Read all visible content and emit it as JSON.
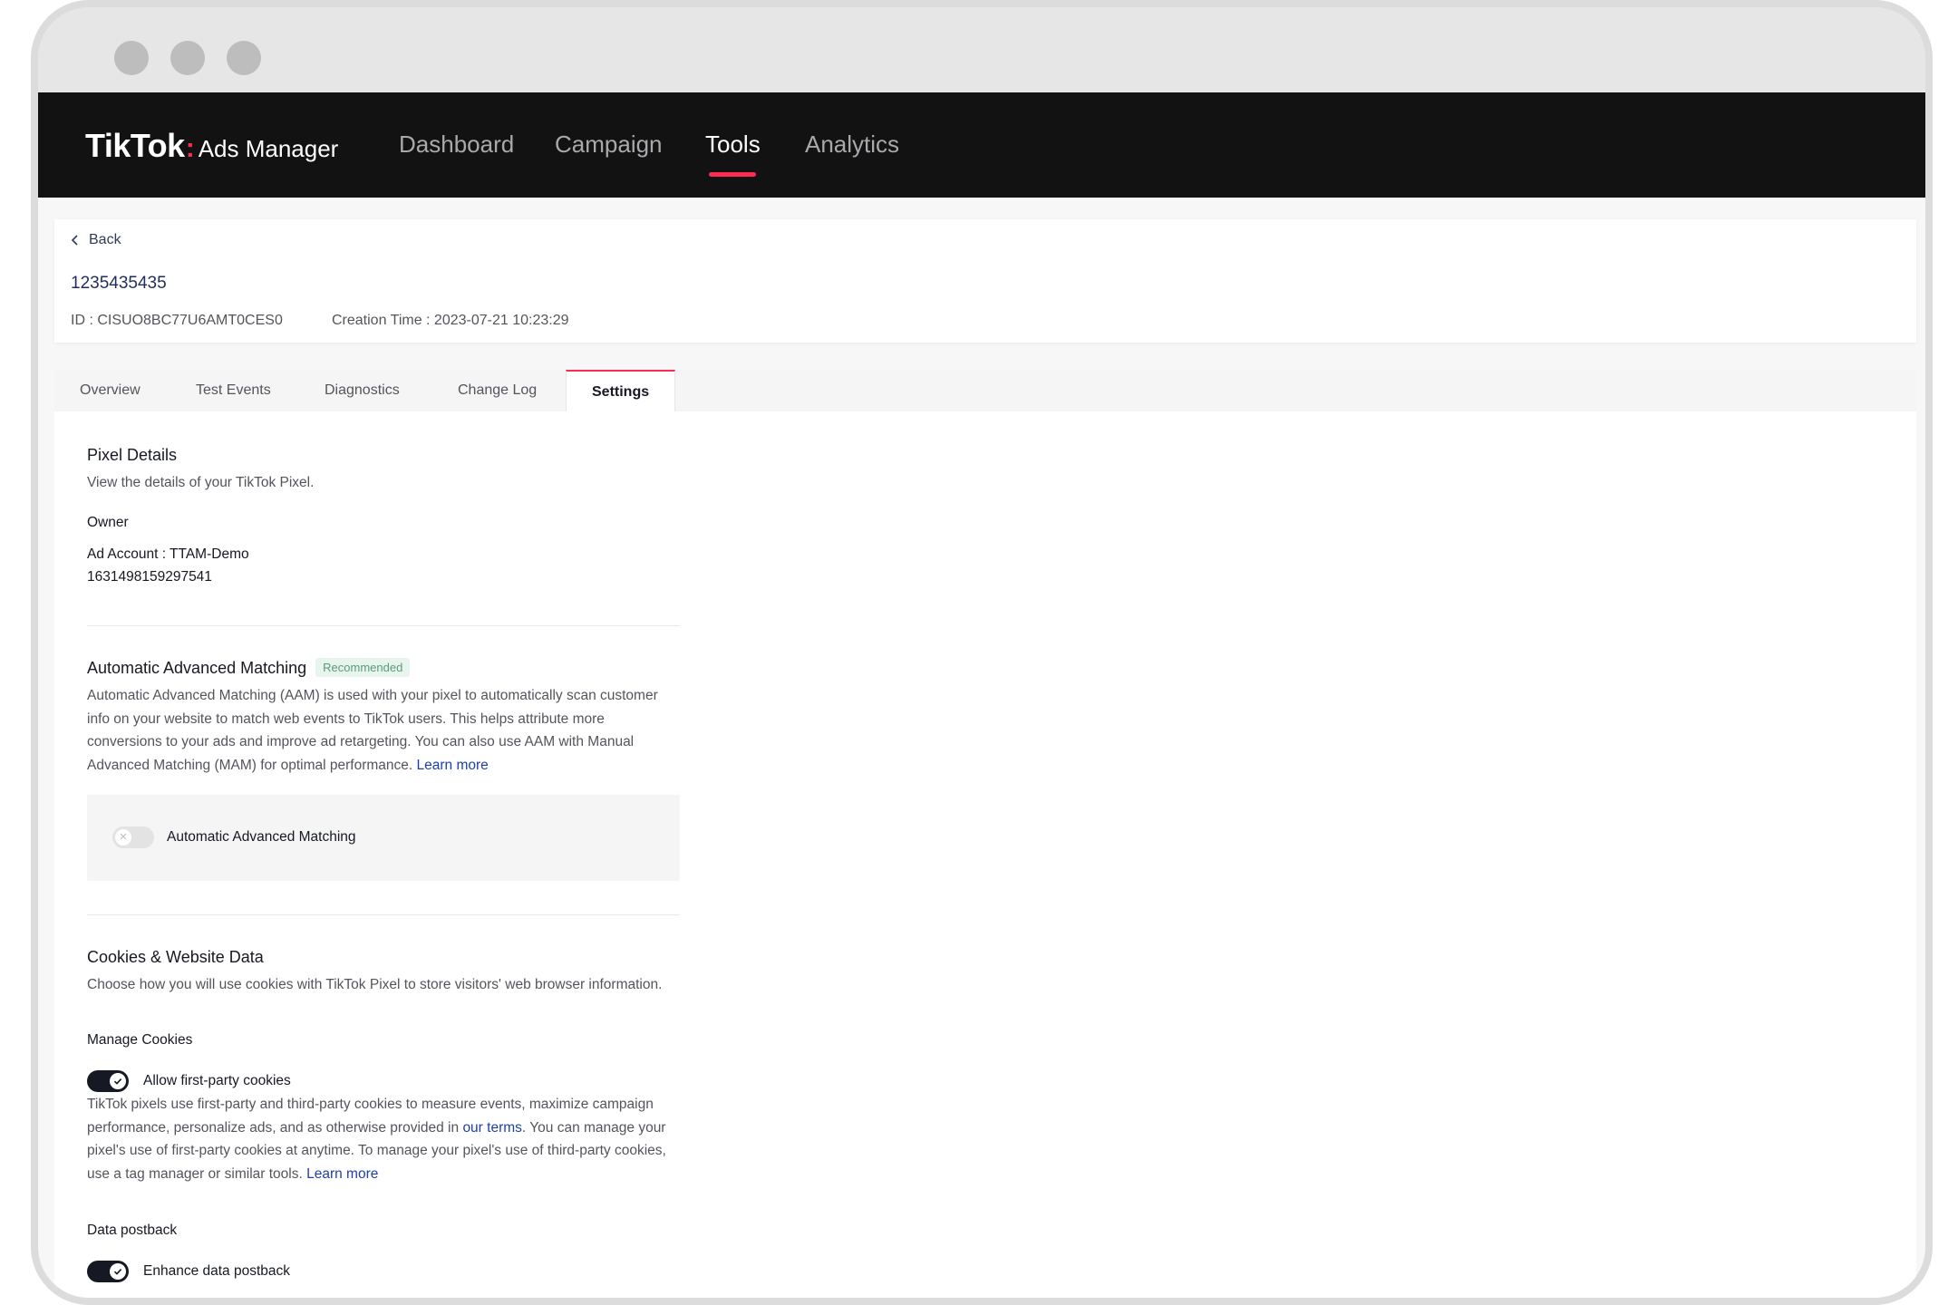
{
  "window": {
    "controls": [
      "close",
      "minimize",
      "maximize"
    ]
  },
  "navbar": {
    "brand": "TikTok",
    "brand_colon": ":",
    "product": "Ads Manager",
    "items": [
      {
        "label": "Dashboard",
        "active": false
      },
      {
        "label": "Campaign",
        "active": false
      },
      {
        "label": "Tools",
        "active": true
      },
      {
        "label": "Analytics",
        "active": false
      }
    ],
    "accent_color": "#fe2c55"
  },
  "header": {
    "back_label": "Back",
    "pixel_name": "1235435435",
    "id_text": "ID : CISUO8BC77U6AMT0CES0",
    "creation_time": "Creation Time : 2023-07-21 10:23:29"
  },
  "tabs": [
    {
      "label": "Overview",
      "active": false
    },
    {
      "label": "Test Events",
      "active": false
    },
    {
      "label": "Diagnostics",
      "active": false
    },
    {
      "label": "Change Log",
      "active": false
    },
    {
      "label": "Settings",
      "active": true
    }
  ],
  "pixel_details": {
    "title": "Pixel Details",
    "description": "View the details of your TikTok Pixel.",
    "owner_label": "Owner",
    "owner_account": "Ad Account : TTAM-Demo",
    "owner_id": "1631498159297541"
  },
  "aam": {
    "title": "Automatic Advanced Matching",
    "badge": "Recommended",
    "description": "Automatic Advanced Matching (AAM) is used with your pixel to automatically scan customer info on your website to match web events to TikTok users. This helps attribute more conversions to your ads and improve ad retargeting. You can also use AAM with Manual Advanced Matching (MAM) for optimal performance. ",
    "learn_more": "Learn more",
    "toggle_label": "Automatic Advanced Matching",
    "toggle_on": false
  },
  "cookies": {
    "title": "Cookies & Website Data",
    "description": "Choose how you will use cookies with TikTok Pixel to store visitors' web browser information.",
    "manage_label": "Manage Cookies",
    "first_party_label": "Allow first-party cookies",
    "first_party_on": true,
    "first_party_desc_1": "TikTok pixels use first-party and third-party cookies to measure events, maximize campaign performance, personalize ads, and as otherwise provided in ",
    "terms_link": "our terms",
    "first_party_desc_2": ". You can manage your pixel's use of first-party cookies at anytime. To manage your pixel's use of third-party cookies, use a tag manager or similar tools. ",
    "learn_more": "Learn more",
    "postback_label": "Data postback",
    "postback_toggle_label": "Enhance data postback",
    "postback_on": true
  }
}
